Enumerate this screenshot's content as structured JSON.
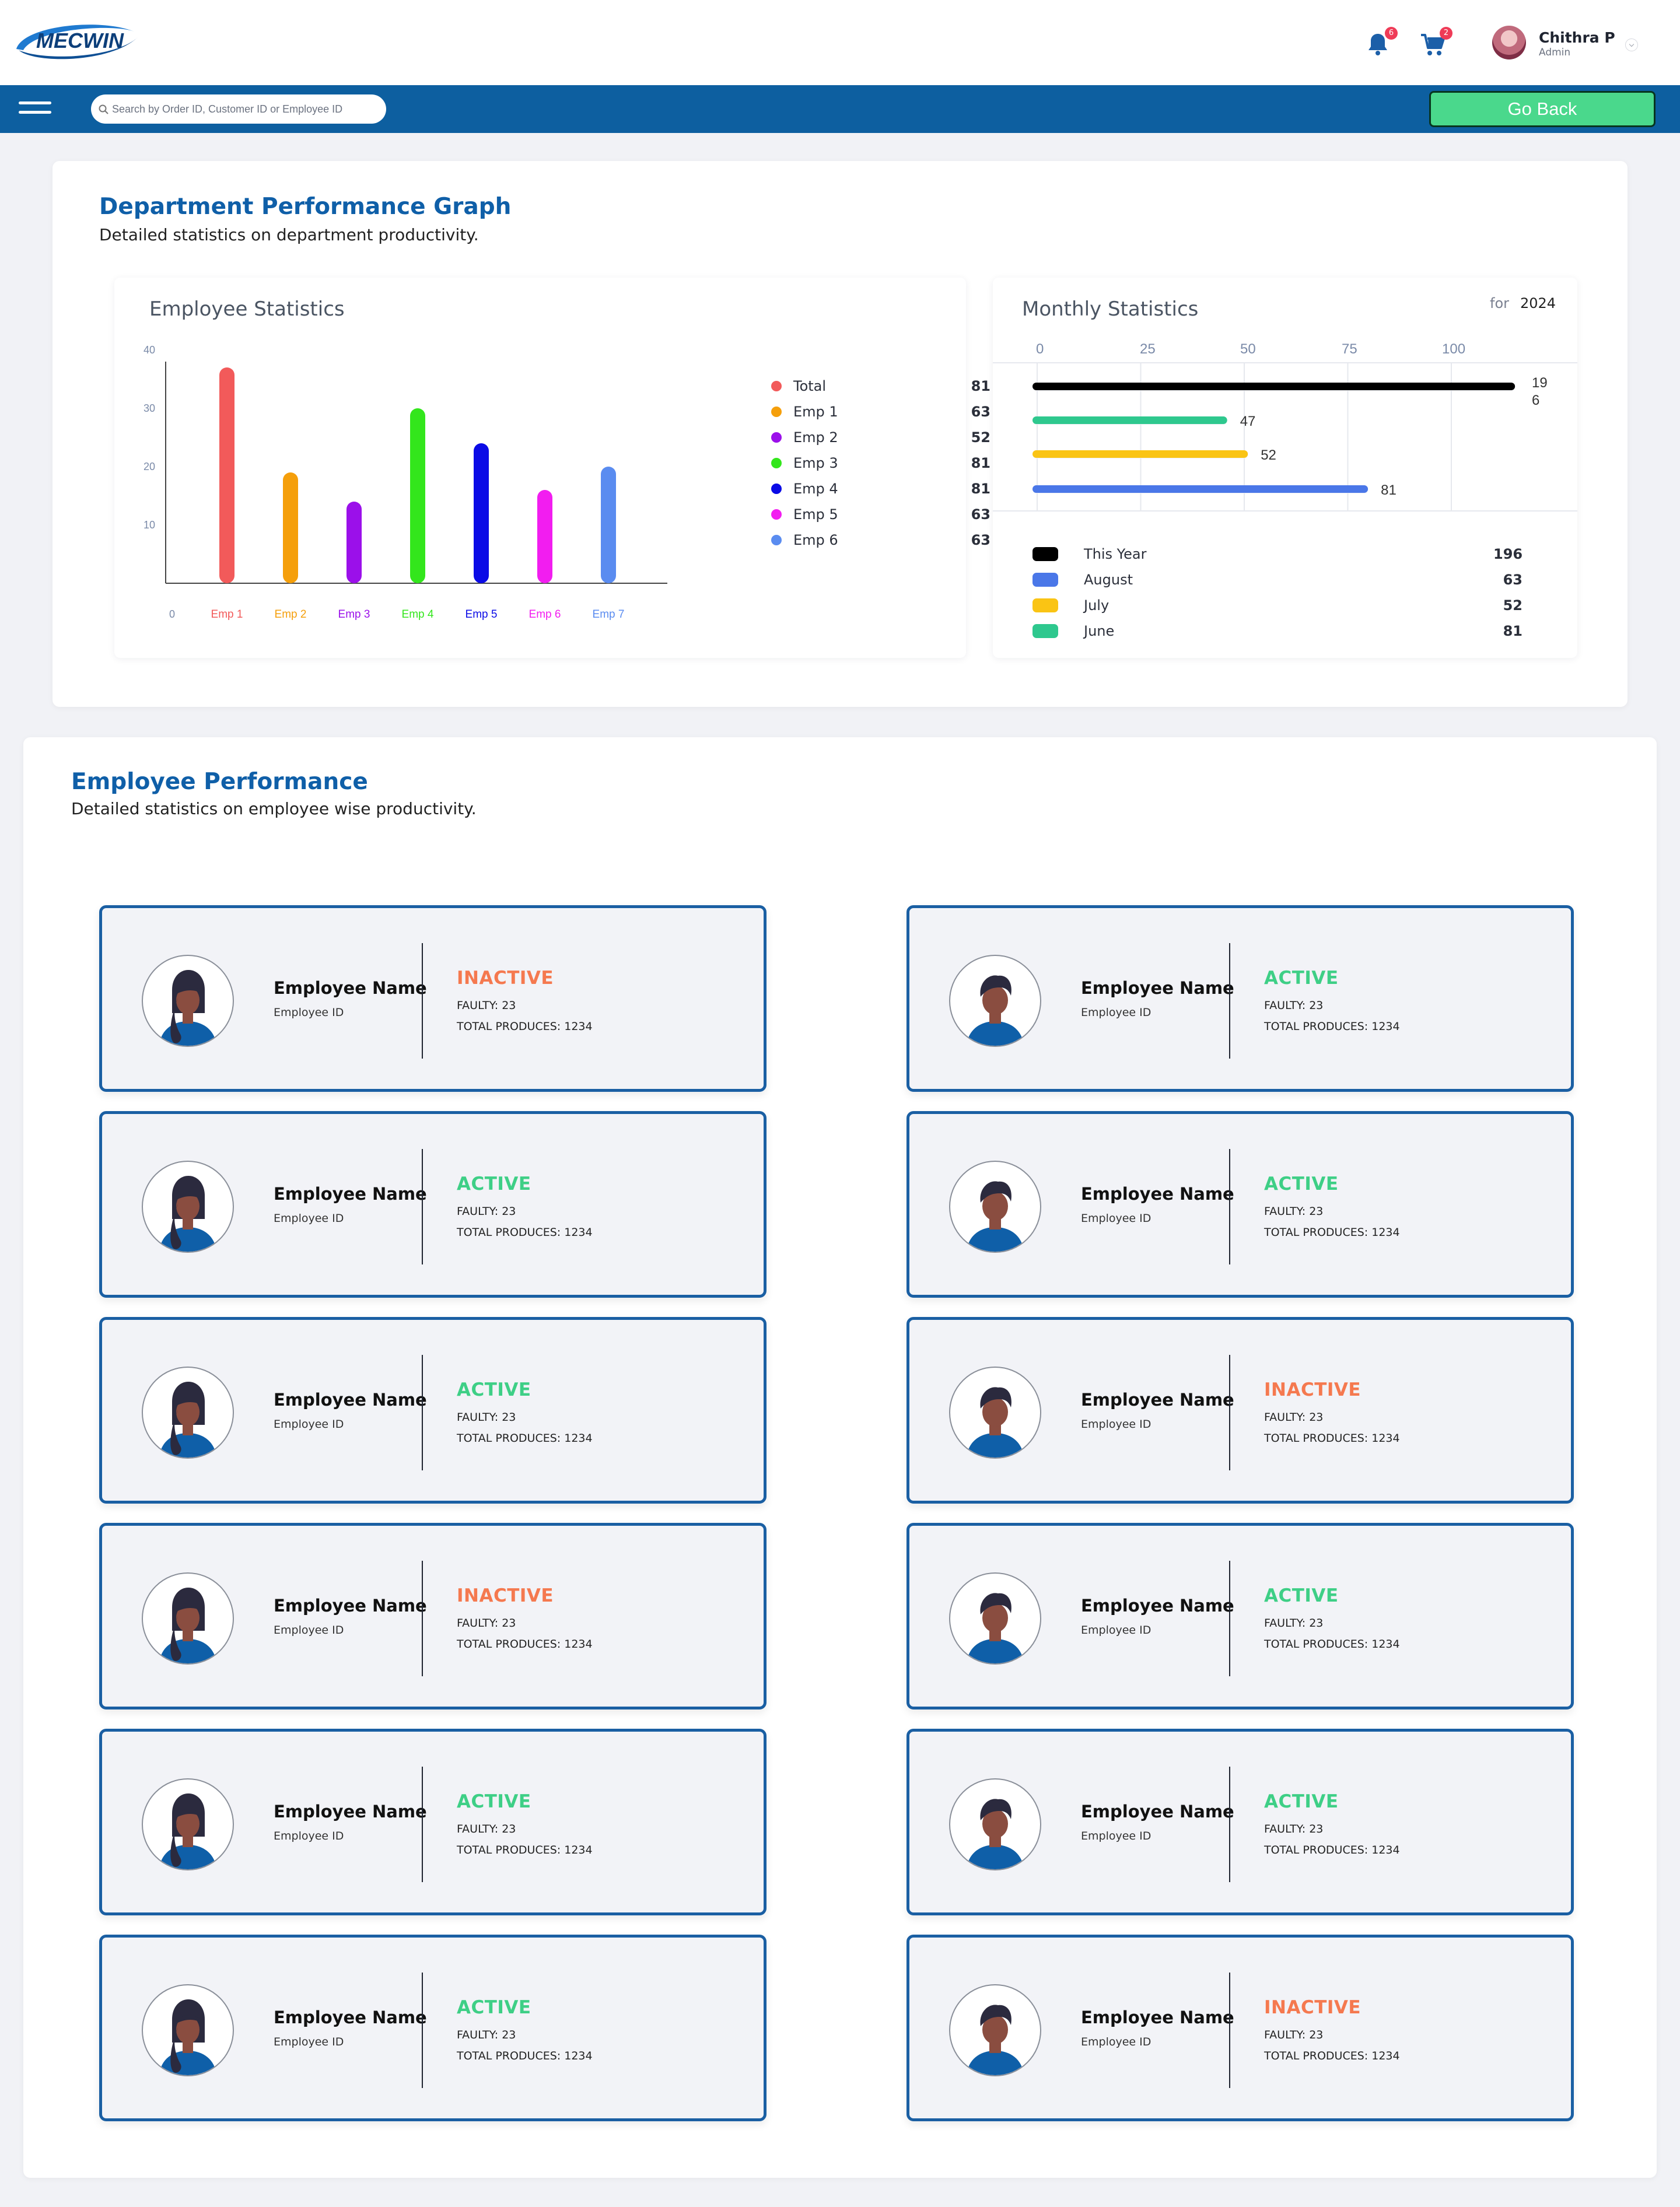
{
  "header": {
    "logo_text": "MECWIN",
    "notifications_count": "6",
    "cart_count": "2",
    "user_name": "Chithra P",
    "user_role": "Admin"
  },
  "navbar": {
    "search_placeholder": "Search by Order ID, Customer ID or Employee ID",
    "go_back_label": "Go Back"
  },
  "department": {
    "title": "Department Performance Graph",
    "subtitle": "Detailed statistics on department productivity."
  },
  "employee_statistics": {
    "title": "Employee Statistics",
    "legend": [
      {
        "label": "Total",
        "value": "81",
        "color": "#f25a5a"
      },
      {
        "label": "Emp 1",
        "value": "63",
        "color": "#f59f0b"
      },
      {
        "label": "Emp 2",
        "value": "52",
        "color": "#9b10ea"
      },
      {
        "label": "Emp 3",
        "value": "81",
        "color": "#33e61c"
      },
      {
        "label": "Emp 4",
        "value": "81",
        "color": "#0b0be6"
      },
      {
        "label": "Emp 5",
        "value": "63",
        "color": "#f21df0"
      },
      {
        "label": "Emp 6",
        "value": "63",
        "color": "#5a8cf0"
      }
    ]
  },
  "monthly_statistics": {
    "title": "Monthly Statistics",
    "for_label": "for",
    "year": "2024",
    "legend": [
      {
        "label": "This Year",
        "value": "196",
        "color": "#000000"
      },
      {
        "label": "August",
        "value": "63",
        "color": "#4a77e8"
      },
      {
        "label": "July",
        "value": "52",
        "color": "#fac414"
      },
      {
        "label": "June",
        "value": "81",
        "color": "#2ec88e"
      }
    ]
  },
  "chart_data": [
    {
      "type": "bar",
      "title": "Employee Statistics",
      "categories": [
        "Emp 1",
        "Emp 2",
        "Emp 3",
        "Emp 4",
        "Emp 5",
        "Emp 6",
        "Emp 7"
      ],
      "values": [
        37,
        19,
        14,
        30,
        24,
        16,
        20
      ],
      "colors": [
        "#f25a5a",
        "#f59f0b",
        "#9b10ea",
        "#33e61c",
        "#0b0be6",
        "#f21df0",
        "#5a8cf0"
      ],
      "yticks": [
        10,
        20,
        30,
        40
      ],
      "xlabel_origin": "0",
      "ylim": [
        0,
        40
      ],
      "grid": false
    },
    {
      "type": "bar",
      "orientation": "horizontal",
      "title": "Monthly Statistics",
      "xticks": [
        0,
        25,
        50,
        75,
        100
      ],
      "xlim": [
        0,
        100
      ],
      "bars": [
        {
          "value": 196,
          "label": "196",
          "color": "#000000"
        },
        {
          "value": 47,
          "label": "47",
          "color": "#2ec88e"
        },
        {
          "value": 52,
          "label": "52",
          "color": "#fac414"
        },
        {
          "value": 81,
          "label": "81",
          "color": "#4a77e8"
        }
      ],
      "grid": true
    }
  ],
  "employee_performance": {
    "title": "Employee Performance",
    "subtitle": "Detailed statistics on employee wise productivity.",
    "employees": [
      {
        "name": "Employee Name",
        "id": "Employee ID",
        "status": "INACTIVE",
        "faulty": "FAULTY: 23",
        "total": "TOTAL PRODUCES: 1234",
        "avatar": "female-icon"
      },
      {
        "name": "Employee Name",
        "id": "Employee ID",
        "status": "ACTIVE",
        "faulty": "FAULTY: 23",
        "total": "TOTAL PRODUCES: 1234",
        "avatar": "male-icon"
      },
      {
        "name": "Employee Name",
        "id": "Employee ID",
        "status": "ACTIVE",
        "faulty": "FAULTY: 23",
        "total": "TOTAL PRODUCES: 1234",
        "avatar": "female-icon"
      },
      {
        "name": "Employee Name",
        "id": "Employee ID",
        "status": "ACTIVE",
        "faulty": "FAULTY: 23",
        "total": "TOTAL PRODUCES: 1234",
        "avatar": "male-icon"
      },
      {
        "name": "Employee Name",
        "id": "Employee ID",
        "status": "ACTIVE",
        "faulty": "FAULTY: 23",
        "total": "TOTAL PRODUCES: 1234",
        "avatar": "female-icon"
      },
      {
        "name": "Employee Name",
        "id": "Employee ID",
        "status": "INACTIVE",
        "faulty": "FAULTY: 23",
        "total": "TOTAL PRODUCES: 1234",
        "avatar": "male-icon"
      },
      {
        "name": "Employee Name",
        "id": "Employee ID",
        "status": "INACTIVE",
        "faulty": "FAULTY: 23",
        "total": "TOTAL PRODUCES: 1234",
        "avatar": "female-icon"
      },
      {
        "name": "Employee Name",
        "id": "Employee ID",
        "status": "ACTIVE",
        "faulty": "FAULTY: 23",
        "total": "TOTAL PRODUCES: 1234",
        "avatar": "male-icon"
      },
      {
        "name": "Employee Name",
        "id": "Employee ID",
        "status": "ACTIVE",
        "faulty": "FAULTY: 23",
        "total": "TOTAL PRODUCES: 1234",
        "avatar": "female-icon"
      },
      {
        "name": "Employee Name",
        "id": "Employee ID",
        "status": "ACTIVE",
        "faulty": "FAULTY: 23",
        "total": "TOTAL PRODUCES: 1234",
        "avatar": "male-icon"
      },
      {
        "name": "Employee Name",
        "id": "Employee ID",
        "status": "ACTIVE",
        "faulty": "FAULTY: 23",
        "total": "TOTAL PRODUCES: 1234",
        "avatar": "female-icon"
      },
      {
        "name": "Employee Name",
        "id": "Employee ID",
        "status": "INACTIVE",
        "faulty": "FAULTY: 23",
        "total": "TOTAL PRODUCES: 1234",
        "avatar": "male-icon"
      }
    ],
    "status_colors": {
      "ACTIVE": "#3ecf86",
      "INACTIVE": "#f5794f"
    }
  }
}
